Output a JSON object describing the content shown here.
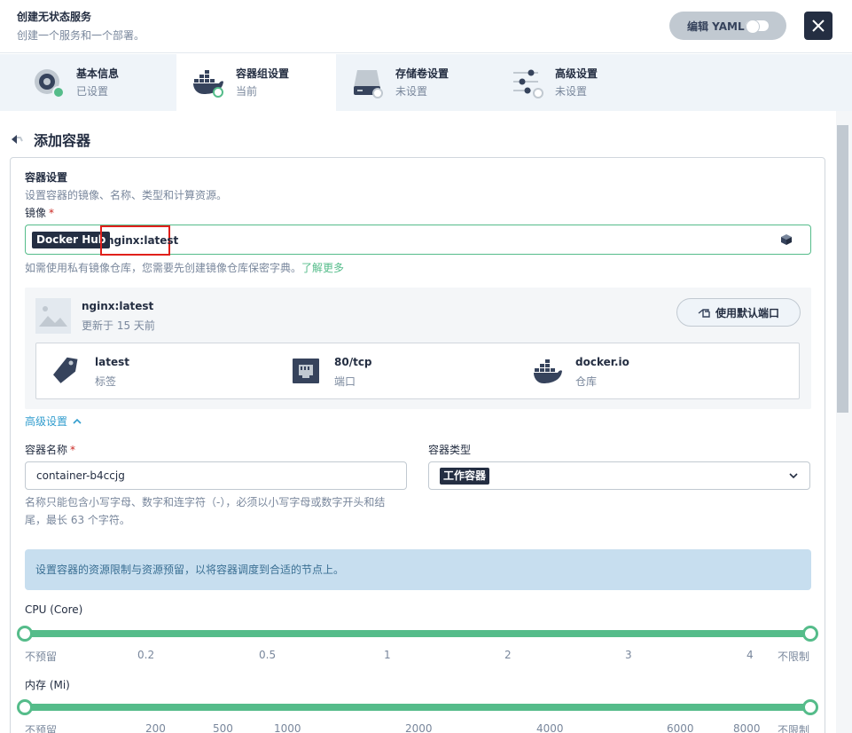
{
  "header": {
    "title": "创建无状态服务",
    "subtitle": "创建一个服务和一个部署。",
    "yaml_label": "编辑 YAML"
  },
  "tabs": [
    {
      "label": "基本信息",
      "status": "已设置"
    },
    {
      "label": "容器组设置",
      "status": "当前"
    },
    {
      "label": "存储卷设置",
      "status": "未设置"
    },
    {
      "label": "高级设置",
      "status": "未设置"
    }
  ],
  "back_label": "添加容器",
  "container": {
    "section_title": "容器设置",
    "section_desc": "设置容器的镜像、名称、类型和计算资源。",
    "image_label": "镜像",
    "required_mark": "*",
    "registry": "Docker Hub",
    "image_value": "nginx:latest",
    "hint": "如需使用私有镜像仓库，您需要先创建镜像仓库保密字典。",
    "hint_link": "了解更多"
  },
  "image_card": {
    "name": "nginx:latest",
    "updated": "更新于 15 天前",
    "port_button": "使用默认端口",
    "items": [
      {
        "value": "latest",
        "key": "标签",
        "icon": "tag-icon"
      },
      {
        "value": "80/tcp",
        "key": "端口",
        "icon": "ethernet-port-icon"
      },
      {
        "value": "docker.io",
        "key": "仓库",
        "icon": "docker-icon"
      }
    ]
  },
  "advanced": {
    "label": "高级设置",
    "name_label": "容器名称",
    "name_value": "container-b4ccjg",
    "type_label": "容器类型",
    "type_value": "工作容器",
    "name_hint": "名称只能包含小写字母、数字和连字符（-），必须以小写字母或数字开头和结尾，最长 63 个字符。"
  },
  "resource_hint": "设置容器的资源限制与资源预留，以将容器调度到合适的节点上。",
  "cpu": {
    "label": "CPU (Core)",
    "ticks": [
      "不预留",
      "0.2",
      "0.5",
      "1",
      "2",
      "3",
      "4",
      "不限制"
    ],
    "range": [
      "不预留",
      "不限制"
    ]
  },
  "memory": {
    "label": "内存 (Mi)",
    "ticks": [
      "不预留",
      "200",
      "500",
      "1000",
      "2000",
      "4000",
      "6000",
      "8000",
      "不限制"
    ],
    "range": [
      "不预留",
      "不限制"
    ]
  },
  "colors": {
    "accent": "#55bc8a",
    "dark": "#242e42",
    "highlight": "#e0201b"
  }
}
